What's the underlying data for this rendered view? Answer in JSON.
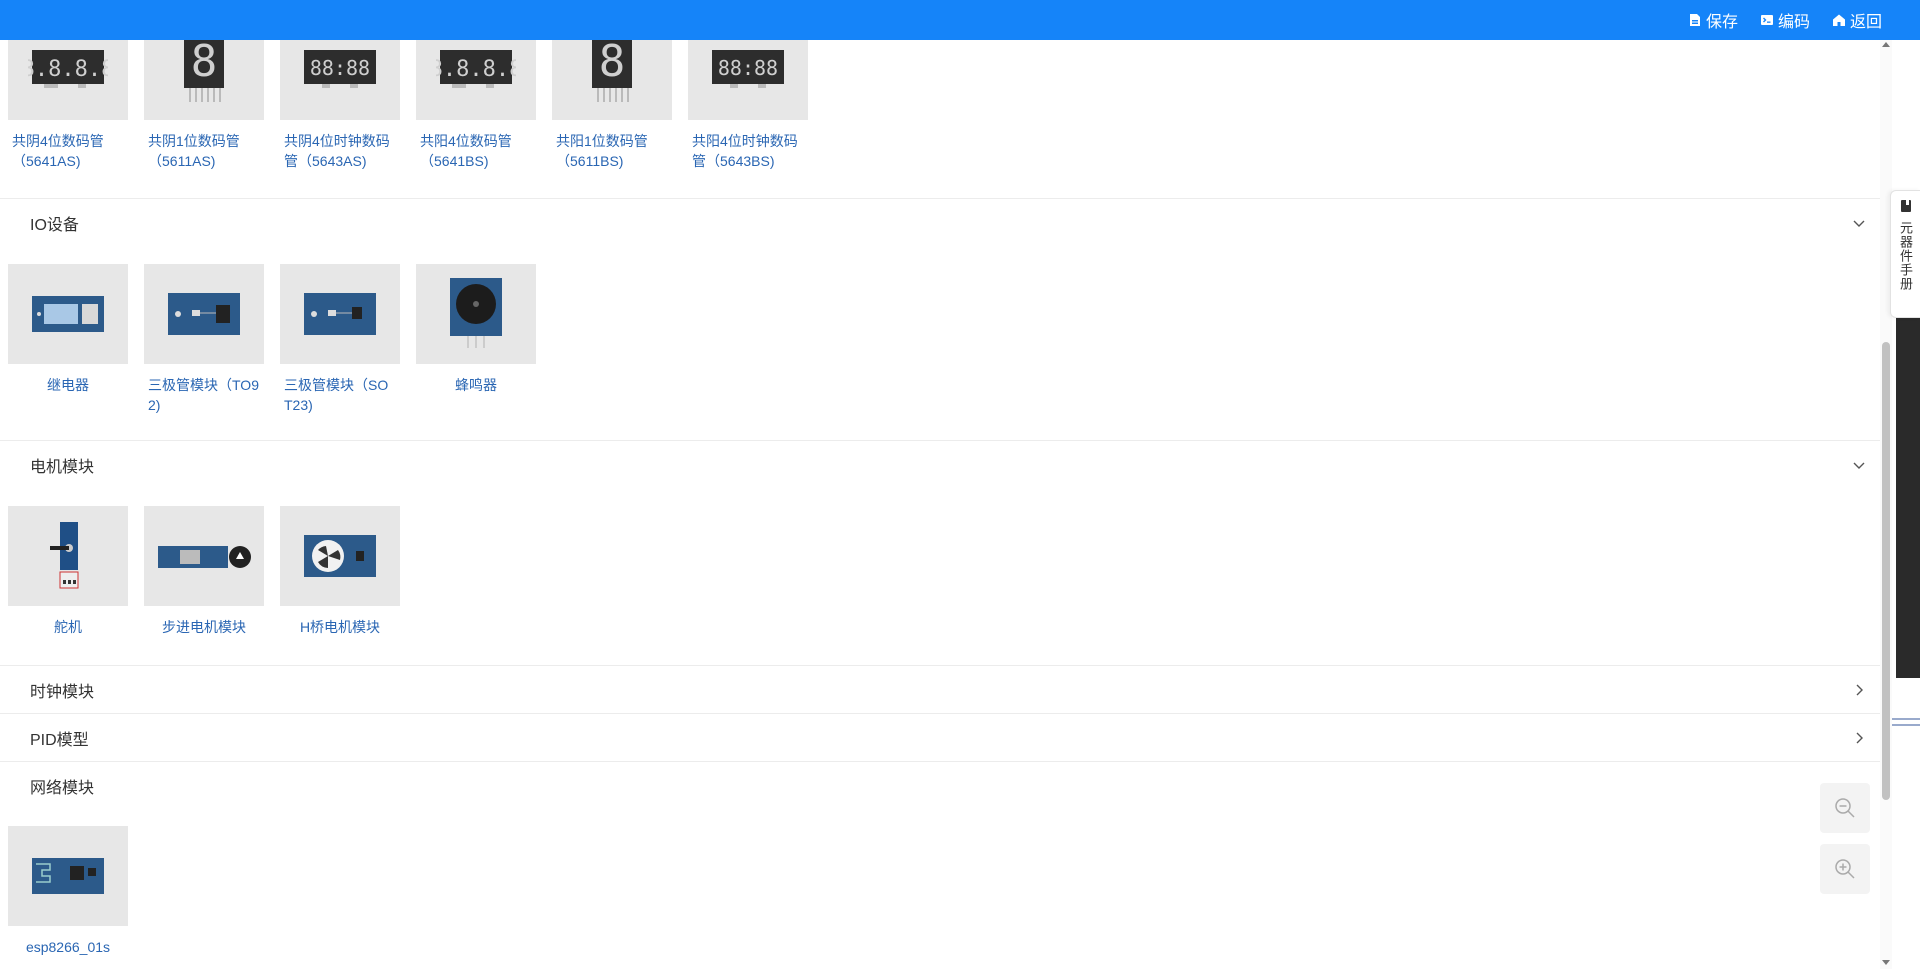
{
  "toolbar": {
    "save_label": "保存",
    "code_label": "编码",
    "back_label": "返回"
  },
  "side_tab": {
    "label": "元器件手册"
  },
  "top_cards": [
    {
      "name": "共阴4位数码管（5641AS)"
    },
    {
      "name": "共阴1位数码管（5611AS)"
    },
    {
      "name": "共阴4位时钟数码管（5643AS)"
    },
    {
      "name": "共阳4位数码管（5641BS)"
    },
    {
      "name": "共阳1位数码管（5611BS)"
    },
    {
      "name": "共阳4位时钟数码管（5643BS)"
    }
  ],
  "sections": {
    "io": {
      "title": "IO设备",
      "items": [
        {
          "name": "继电器"
        },
        {
          "name": "三极管模块（TO92)"
        },
        {
          "name": "三极管模块（SOT23)"
        },
        {
          "name": "蜂鸣器"
        }
      ]
    },
    "motor": {
      "title": "电机模块",
      "items": [
        {
          "name": "舵机"
        },
        {
          "name": "步进电机模块"
        },
        {
          "name": "H桥电机模块"
        }
      ]
    },
    "clock": {
      "title": "时钟模块"
    },
    "pid": {
      "title": "PID模型"
    },
    "network": {
      "title": "网络模块",
      "items": [
        {
          "name": "esp8266_01s"
        }
      ]
    }
  },
  "colors": {
    "topbar": "#1584f9",
    "link": "#2a66b3",
    "thumb_bg": "#e7e7e7",
    "pcb_blue": "#2c5a8a"
  },
  "icons": {
    "save": "file-icon",
    "code": "terminal-icon",
    "back": "home-icon",
    "expand": "chevron-down-icon",
    "collapse": "chevron-right-icon",
    "zoom_out": "zoom-out-icon",
    "zoom_in": "zoom-in-icon",
    "manual": "book-icon"
  }
}
